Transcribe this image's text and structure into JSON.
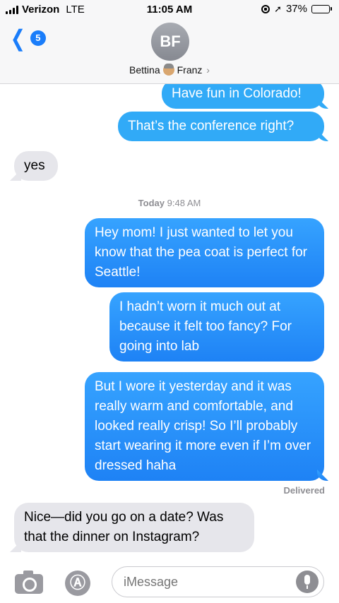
{
  "status_bar": {
    "carrier": "Verizon",
    "network": "LTE",
    "time": "11:05 AM",
    "battery_percent": "37%",
    "battery_level": 0.37,
    "battery_color": "#f4c20d"
  },
  "header": {
    "back_count": "5",
    "avatar_initials": "BF",
    "contact_first": "Bettina",
    "contact_last": "Franz",
    "contact_emoji": "grandma-face-icon"
  },
  "thread": {
    "messages": [
      {
        "from": "me",
        "text": "Have fun in Colorado!"
      },
      {
        "from": "me",
        "text": "That’s the conference right?"
      },
      {
        "from": "them",
        "text": "yes"
      },
      {
        "from": "me",
        "text": "Hey mom! I just wanted to let you know that the pea coat is perfect for Seattle!"
      },
      {
        "from": "me",
        "text": "I hadn’t worn it much out at because it felt too fancy? For going into lab"
      },
      {
        "from": "me",
        "text": "But I wore it yesterday and it was really warm and comfortable, and looked really crisp! So I’ll probably start wearing it more even if I’m over dressed haha"
      },
      {
        "from": "them",
        "text": "Nice—did you go on a date? Was that the dinner on Instagram?"
      }
    ],
    "timestamp_day": "Today",
    "timestamp_time": "9:48 AM",
    "delivered_label": "Delivered"
  },
  "input_bar": {
    "placeholder": "iMessage"
  },
  "colors": {
    "outgoing_bubble": "#1e82f5",
    "incoming_bubble": "#e6e6eb",
    "accent": "#1a7dfa"
  }
}
